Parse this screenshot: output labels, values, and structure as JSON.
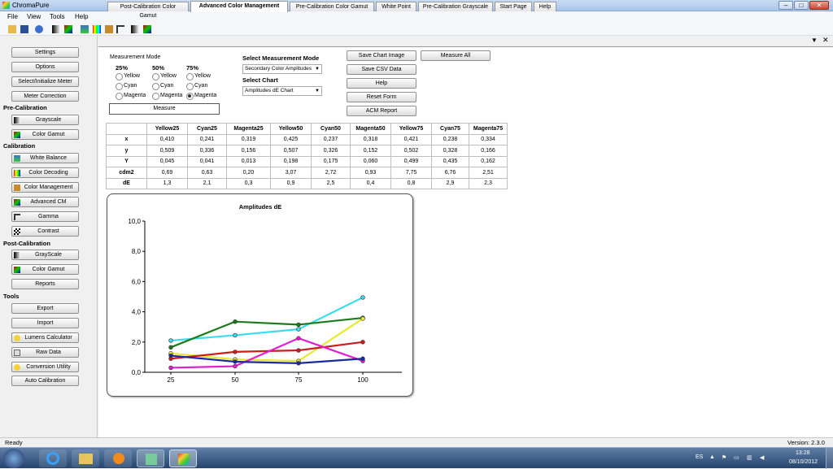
{
  "window": {
    "title": "ChromaPure"
  },
  "menu": [
    "File",
    "View",
    "Tools",
    "Help"
  ],
  "toolbar_icons": [
    "open-folder-icon",
    "save-icon",
    "help-icon",
    "grayscale-icon",
    "chromaticity-icon",
    "chart-icon",
    "color-bars-icon",
    "settings-tools-icon",
    "gamma-icon",
    "grayscale-icon",
    "chromaticity-icon"
  ],
  "sidebar": {
    "top_buttons": [
      "Settings",
      "Options",
      "Select/Initialize Meter",
      "Meter Correction"
    ],
    "pre_calibration": {
      "heading": "Pre-Calibration",
      "buttons": [
        "Grayscale",
        "Color Gamut"
      ]
    },
    "calibration": {
      "heading": "Calibration",
      "buttons": [
        "White Balance",
        "Color Decoding",
        "Color Management",
        "Advanced CM",
        "Gamma",
        "Contrast"
      ]
    },
    "post_calibration": {
      "heading": "Post-Calibration",
      "buttons": [
        "GrayScale",
        "Color Gamut",
        "Reports"
      ]
    },
    "tools": {
      "heading": "Tools",
      "buttons": [
        "Export",
        "Import",
        "Lumens Calculator",
        "Raw Data",
        "Conversion Utility",
        "Auto Calibration"
      ]
    }
  },
  "tabs": [
    "Post-Calibration Color Gamut",
    "Advanced Color Management",
    "Pre-Calibration Color Gamut",
    "White Point",
    "Pre-Calibration Grayscale",
    "Start Page",
    "Help"
  ],
  "active_tab": "Advanced Color Management",
  "measurement_mode": {
    "title": "Measurement Mode",
    "columns": [
      {
        "heading": "25%",
        "options": [
          "Yellow",
          "Cyan",
          "Magenta"
        ],
        "selected": ""
      },
      {
        "heading": "50%",
        "options": [
          "Yellow",
          "Cyan",
          "Magenta"
        ],
        "selected": ""
      },
      {
        "heading": "75%",
        "options": [
          "Yellow",
          "Cyan",
          "Magenta"
        ],
        "selected": "Magenta"
      }
    ],
    "measure_button": "Measure"
  },
  "select_mode": {
    "label": "Select Measurement Mode",
    "value": "Secondary Color Amplitudes"
  },
  "select_chart": {
    "label": "Select Chart",
    "value": "Amplitudes dE Chart"
  },
  "action_buttons": [
    "Save Chart Image",
    "Save CSV Data",
    "Help",
    "Reset Form",
    "ACM Report"
  ],
  "measure_all_button": "Measure All",
  "table": {
    "columns": [
      "",
      "Yellow25",
      "Cyan25",
      "Magenta25",
      "Yellow50",
      "Cyan50",
      "Magenta50",
      "Yellow75",
      "Cyan75",
      "Magenta75"
    ],
    "rows": [
      [
        "x",
        "0,410",
        "0,241",
        "0,319",
        "0,425",
        "0,237",
        "0,318",
        "0,421",
        "0,238",
        "0,334"
      ],
      [
        "y",
        "0,509",
        "0,336",
        "0,156",
        "0,507",
        "0,326",
        "0,152",
        "0,502",
        "0,328",
        "0,166"
      ],
      [
        "Y",
        "0,045",
        "0,041",
        "0,013",
        "0,198",
        "0,175",
        "0,060",
        "0,499",
        "0,435",
        "0,162"
      ],
      [
        "cdm2",
        "0,69",
        "0,63",
        "0,20",
        "3,07",
        "2,72",
        "0,93",
        "7,75",
        "6,76",
        "2,51"
      ],
      [
        "dE",
        "1,3",
        "2,1",
        "0,3",
        "0,9",
        "2,5",
        "0,4",
        "0,8",
        "2,9",
        "2,3"
      ]
    ]
  },
  "chart_data": {
    "type": "line",
    "title": "Amplitudes dE",
    "x": [
      25,
      50,
      75,
      100
    ],
    "x_tick_labels": [
      "25",
      "50",
      "75",
      "100"
    ],
    "y_tick_labels": [
      "0,0",
      "2,0",
      "4,0",
      "6,0",
      "8,0",
      "10,0"
    ],
    "ylim": [
      0,
      10
    ],
    "grid": false,
    "series": [
      {
        "color": "#3cdcec",
        "values": [
          2.1,
          2.45,
          2.85,
          4.95
        ]
      },
      {
        "color": "#1e7a1e",
        "values": [
          1.65,
          3.35,
          3.15,
          3.6
        ]
      },
      {
        "color": "#e8e830",
        "values": [
          1.25,
          0.85,
          0.75,
          3.55
        ]
      },
      {
        "color": "#c81e1e",
        "values": [
          0.9,
          1.35,
          1.45,
          2.0
        ]
      },
      {
        "color": "#e020d0",
        "values": [
          0.3,
          0.4,
          2.25,
          0.75
        ]
      },
      {
        "color": "#1a2aa0",
        "values": [
          1.1,
          0.7,
          0.6,
          0.9
        ]
      }
    ]
  },
  "status": {
    "left": "Ready",
    "right": "Version: 2.3.0"
  },
  "taskbar": {
    "language": "ES",
    "time": "13:28",
    "date": "08/10/2012"
  }
}
